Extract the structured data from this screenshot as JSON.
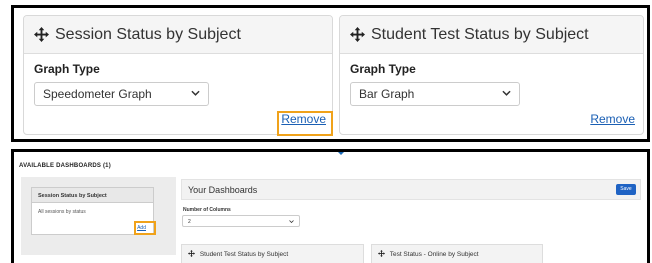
{
  "widgets": [
    {
      "title": "Session Status by Subject",
      "graph_type_label": "Graph Type",
      "graph_type_value": "Speedometer Graph",
      "remove_label": "Remove",
      "remove_highlighted": true
    },
    {
      "title": "Student Test Status by Subject",
      "graph_type_label": "Graph Type",
      "graph_type_value": "Bar Graph",
      "remove_label": "Remove",
      "remove_highlighted": false
    }
  ],
  "available": {
    "heading": "AVAILABLE DASHBOARDS (1)",
    "items": [
      {
        "title": "Session Status by Subject",
        "description": "All sessions by status",
        "add_label": "Add",
        "add_highlighted": true
      }
    ]
  },
  "your_dashboards": {
    "title": "Your Dashboards",
    "save_label": "Save",
    "columns_label": "Number of Columns",
    "columns_value": "2",
    "cards": [
      {
        "title": "Student Test Status by Subject"
      },
      {
        "title": "Test Status - Online by Subject"
      }
    ]
  },
  "colors": {
    "highlight": "#f0a21a",
    "link": "#1a5fb4",
    "primary_button": "#1f63c4"
  },
  "icons": [
    "move-icon",
    "chevron-down-icon"
  ]
}
